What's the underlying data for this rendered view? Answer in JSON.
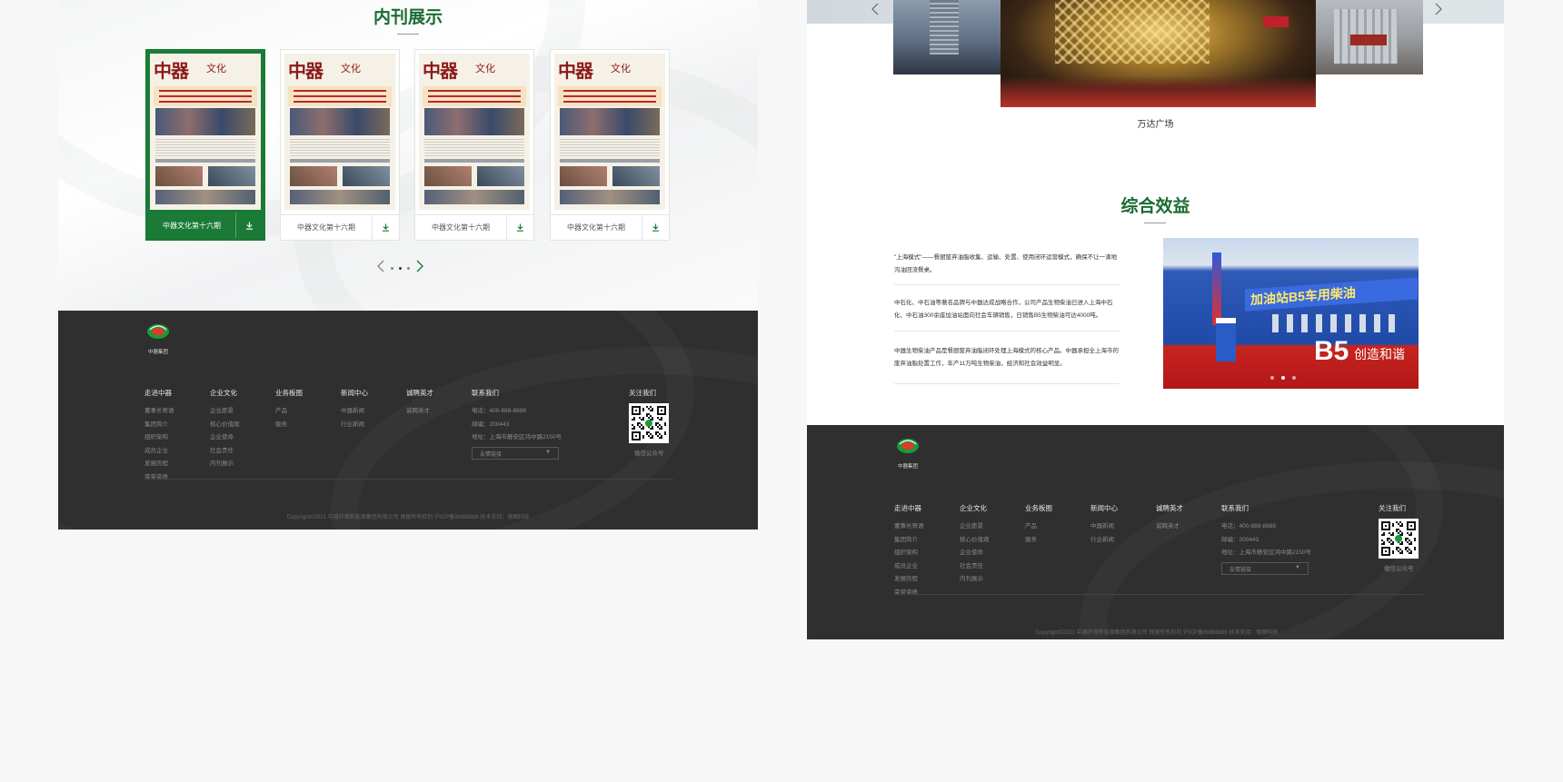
{
  "left": {
    "magazine_section": {
      "title": "内刊展示",
      "cards": [
        {
          "name": "中器文化第十六期",
          "active": true
        },
        {
          "name": "中器文化第十六期",
          "active": false
        },
        {
          "name": "中器文化第十六期",
          "active": false
        },
        {
          "name": "中器文化第十六期",
          "active": false
        }
      ],
      "cover_logo": "中器",
      "cover_logo_sub": "文化",
      "pager": {
        "prev_icon": "chevron-left-icon",
        "next_icon": "chevron-right-icon",
        "dots": 3,
        "active_dot": 1
      }
    }
  },
  "right": {
    "project_slider": {
      "caption": "万达广场",
      "prev_icon": "chevron-left-icon",
      "next_icon": "chevron-right-icon"
    },
    "benefits": {
      "title": "综合效益",
      "paragraphs": [
        "\"上海模式\"——餐厨废弃油脂收集、运输、处置、使用闭环运营模式，确保不让一滴地沟油回流餐桌。",
        "中石化、中石油等著名品牌与中器达成战略合作，公司产品生物柴油已进入上海中石化、中石油300余座加油站面向社会车辆销售，日销售B5生物柴油可达4000吨。",
        "中器生物柴油产品是餐厨废弃油脂闭环处理上海模式的核心产品。中器承担全上海市的废弃油脂处置工作，年产11万吨生物柴油，经济和社会效益明显。"
      ],
      "photo_banner_text": "加油站B5车用柴油",
      "photo_b5": "B5",
      "photo_b5_sub": "创造和谐",
      "photo_dots": 3,
      "photo_active_dot": 1
    }
  },
  "footer": {
    "logo_text": "中器集团",
    "columns": [
      {
        "title": "走进中器",
        "items": [
          "董事长寄语",
          "集团简介",
          "组织架构",
          "成员企业",
          "发展历程",
          "荣誉资质"
        ]
      },
      {
        "title": "企业文化",
        "items": [
          "企业愿景",
          "核心价值观",
          "企业使命",
          "社会责任",
          "内刊展示"
        ]
      },
      {
        "title": "业务板图",
        "items": [
          "产品",
          "服务"
        ]
      },
      {
        "title": "新闻中心",
        "items": [
          "中器新闻",
          "行业新闻"
        ]
      },
      {
        "title": "诚聘英才",
        "items": [
          "诚聘英才"
        ]
      }
    ],
    "contact": {
      "title": "联系我们",
      "phone": "电话：400-888-8888",
      "postcode": "邮编：200443",
      "address": "地址：上海市静安区鸿中路2150号",
      "select_placeholder": "友情链接",
      "select_arrow": "▼"
    },
    "follow": {
      "title": "关注我们",
      "qr_caption": "微信公众号"
    },
    "copyright": "Copyright©2021  中器环保新能源集团有限公司  保留所有权利  沪ICP备88888888  技术支持：德图科技"
  },
  "colors": {
    "brand_green": "#1a7a36",
    "title_green": "#1a6b32",
    "footer_bg": "#2f2f2f"
  }
}
